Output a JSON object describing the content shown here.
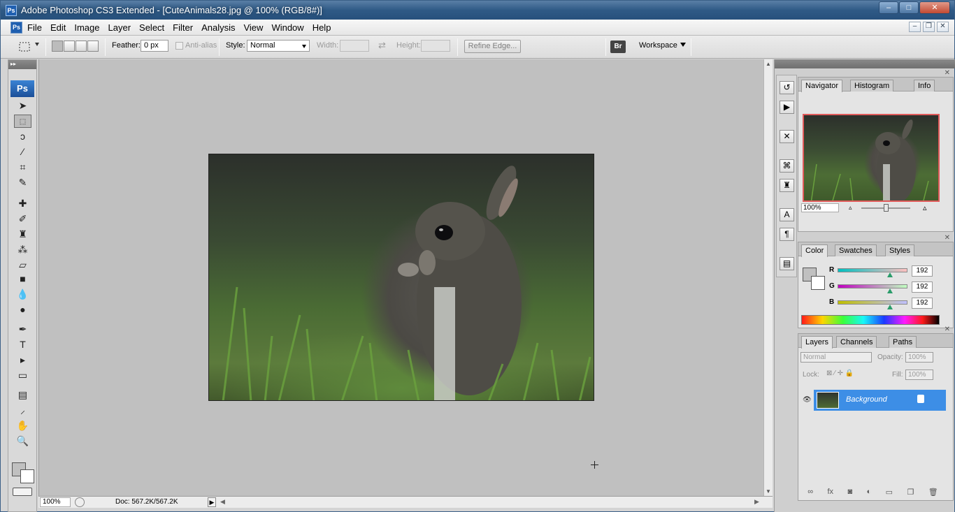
{
  "titlebar": {
    "app_icon_text": "Ps",
    "title": "Adobe Photoshop CS3 Extended - [CuteAnimals28.jpg @ 100% (RGB/8#)]",
    "min": "–",
    "max": "□",
    "close": "✕"
  },
  "menubar": {
    "icon_text": "Ps",
    "items": [
      "File",
      "Edit",
      "Image",
      "Layer",
      "Select",
      "Filter",
      "Analysis",
      "View",
      "Window",
      "Help"
    ],
    "doc_min": "–",
    "doc_restore": "❐",
    "doc_close": "✕"
  },
  "options": {
    "feather_label": "Feather:",
    "feather_value": "0 px",
    "antialias_label": "Anti-alias",
    "style_label": "Style:",
    "style_value": "Normal",
    "width_label": "Width:",
    "height_label": "Height:",
    "refine_edge": "Refine Edge...",
    "workspace": "Workspace"
  },
  "toolbox": {
    "header": "▸▸",
    "logo": "Ps",
    "tools": [
      {
        "name": "move-tool-icon",
        "glyph": "➤"
      },
      {
        "name": "marquee-tool-icon",
        "glyph": "⬚"
      },
      {
        "name": "lasso-tool-icon",
        "glyph": "ↄ"
      },
      {
        "name": "magic-wand-tool-icon",
        "glyph": "⁄"
      },
      {
        "name": "crop-tool-icon",
        "glyph": "⌗"
      },
      {
        "name": "slice-tool-icon",
        "glyph": "✎"
      },
      {
        "name": "healing-brush-tool-icon",
        "glyph": "✚"
      },
      {
        "name": "brush-tool-icon",
        "glyph": "✐"
      },
      {
        "name": "clone-stamp-tool-icon",
        "glyph": "♜"
      },
      {
        "name": "history-brush-tool-icon",
        "glyph": "⁂"
      },
      {
        "name": "eraser-tool-icon",
        "glyph": "▱"
      },
      {
        "name": "gradient-tool-icon",
        "glyph": "■"
      },
      {
        "name": "blur-tool-icon",
        "glyph": "💧"
      },
      {
        "name": "dodge-tool-icon",
        "glyph": "●"
      },
      {
        "name": "pen-tool-icon",
        "glyph": "✒"
      },
      {
        "name": "type-tool-icon",
        "glyph": "T"
      },
      {
        "name": "path-selection-tool-icon",
        "glyph": "▸"
      },
      {
        "name": "shape-tool-icon",
        "glyph": "▭"
      },
      {
        "name": "notes-tool-icon",
        "glyph": "▤"
      },
      {
        "name": "eyedropper-tool-icon",
        "glyph": "⸝"
      },
      {
        "name": "hand-tool-icon",
        "glyph": "✋"
      },
      {
        "name": "zoom-tool-icon",
        "glyph": "🔍"
      }
    ]
  },
  "status": {
    "zoom": "100%",
    "doc": "Doc: 567.2K/567.2K",
    "arrow": "▶"
  },
  "navigator": {
    "tabs": [
      "Navigator",
      "Histogram",
      "Info"
    ],
    "zoom": "100%"
  },
  "color": {
    "tabs": [
      "Color",
      "Swatches",
      "Styles"
    ],
    "channels": [
      {
        "label": "R",
        "value": "192",
        "grad": "linear-gradient(90deg,#00c0c0,#ffc0c0)",
        "level": 0.753
      },
      {
        "label": "G",
        "value": "192",
        "grad": "linear-gradient(90deg,#c000c0,#c0ffc0)",
        "level": 0.753
      },
      {
        "label": "B",
        "value": "192",
        "grad": "linear-gradient(90deg,#c0c000,#c0c0ff)",
        "level": 0.753
      }
    ]
  },
  "layers": {
    "tabs": [
      "Layers",
      "Channels",
      "Paths"
    ],
    "blend": "Normal",
    "opacity_label": "Opacity:",
    "opacity": "100%",
    "lock_label": "Lock:",
    "fill_label": "Fill:",
    "fill": "100%",
    "layer_name": "Background",
    "footer": [
      "∞",
      "fx",
      "◙",
      "◐",
      "▭",
      "❐",
      "🗑"
    ]
  }
}
